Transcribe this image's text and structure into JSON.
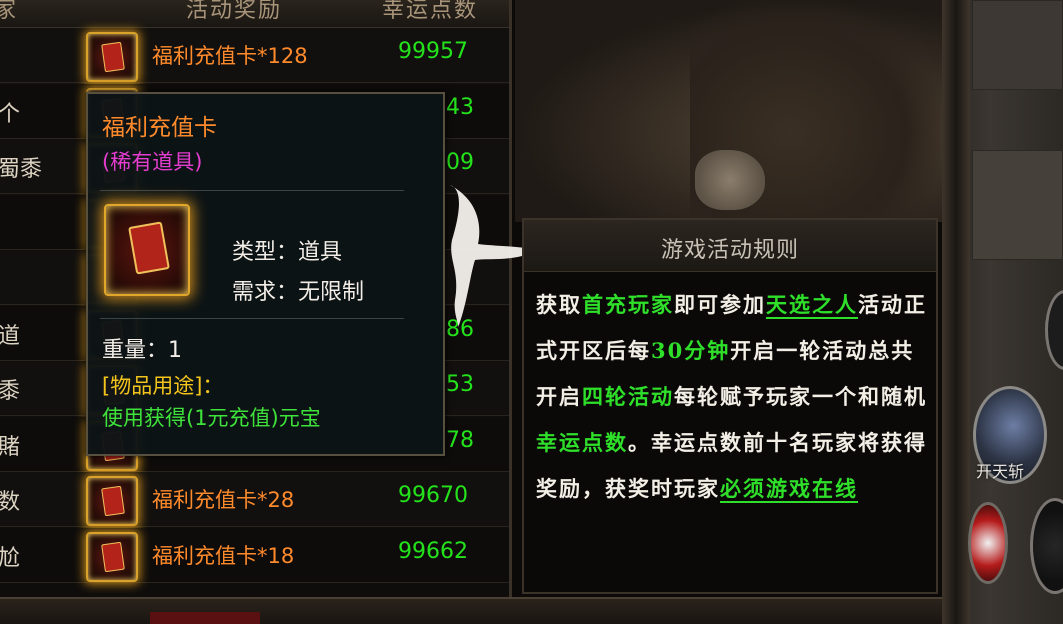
{
  "ranking": {
    "header": {
      "reward_col": "活动奖励",
      "points_col": "幸运点数",
      "left_col": "家"
    },
    "rows": [
      {
        "name": "",
        "reward": "福利充值卡*128",
        "points": "99957"
      },
      {
        "name": "个",
        "reward": "",
        "points": "43"
      },
      {
        "name": "蜀黍",
        "reward": "",
        "points": "09"
      },
      {
        "name": "",
        "reward": "",
        "points": ""
      },
      {
        "name": "",
        "reward": "",
        "points": ""
      },
      {
        "name": "道",
        "reward": "",
        "points": "86"
      },
      {
        "name": "黍",
        "reward": "",
        "points": "53"
      },
      {
        "name": "賭",
        "reward": "",
        "points": "78"
      },
      {
        "name": "数",
        "reward": "福利充值卡*28",
        "points": "99670"
      },
      {
        "name": "尬",
        "reward": "福利充值卡*18",
        "points": "99662"
      }
    ]
  },
  "tooltip": {
    "title": "福利充值卡",
    "rarity": "(稀有道具)",
    "icon": "red-card-icon",
    "type_line": "类型：道具",
    "req_line": "需求：无限制",
    "weight_line": "重量：1",
    "usage_label": "[物品用途]：",
    "usage_desc": "使用获得(1元充值)元宝"
  },
  "rules": {
    "title": "游戏活动规则",
    "segments": [
      {
        "t": "获取",
        "c": "n"
      },
      {
        "t": "首充玩家",
        "c": "hl"
      },
      {
        "t": "即可参加",
        "c": "n"
      },
      {
        "t": "天选之人",
        "c": "ul"
      },
      {
        "t": "活动正式开区后每",
        "c": "n"
      },
      {
        "t": "30分钟",
        "c": "hl"
      },
      {
        "t": "开启一轮活动总共开启",
        "c": "n"
      },
      {
        "t": "四轮活动",
        "c": "hl"
      },
      {
        "t": "每轮赋予玩家一个和随机",
        "c": "n"
      },
      {
        "t": "幸运点数",
        "c": "hl"
      },
      {
        "t": "。幸运点数前十名玩家将获得奖励，获奖时玩家",
        "c": "n"
      },
      {
        "t": "必须游戏在线",
        "c": "ul"
      }
    ]
  },
  "side": {
    "skill_label": "开天斩",
    "skill_icon": "sword-skill-icon"
  },
  "colors": {
    "reward": "#ff8a2b",
    "points": "#24e31c",
    "rarity": "#e43dd0",
    "usage_label": "#f3c41c",
    "highlight": "#2fe02a"
  }
}
